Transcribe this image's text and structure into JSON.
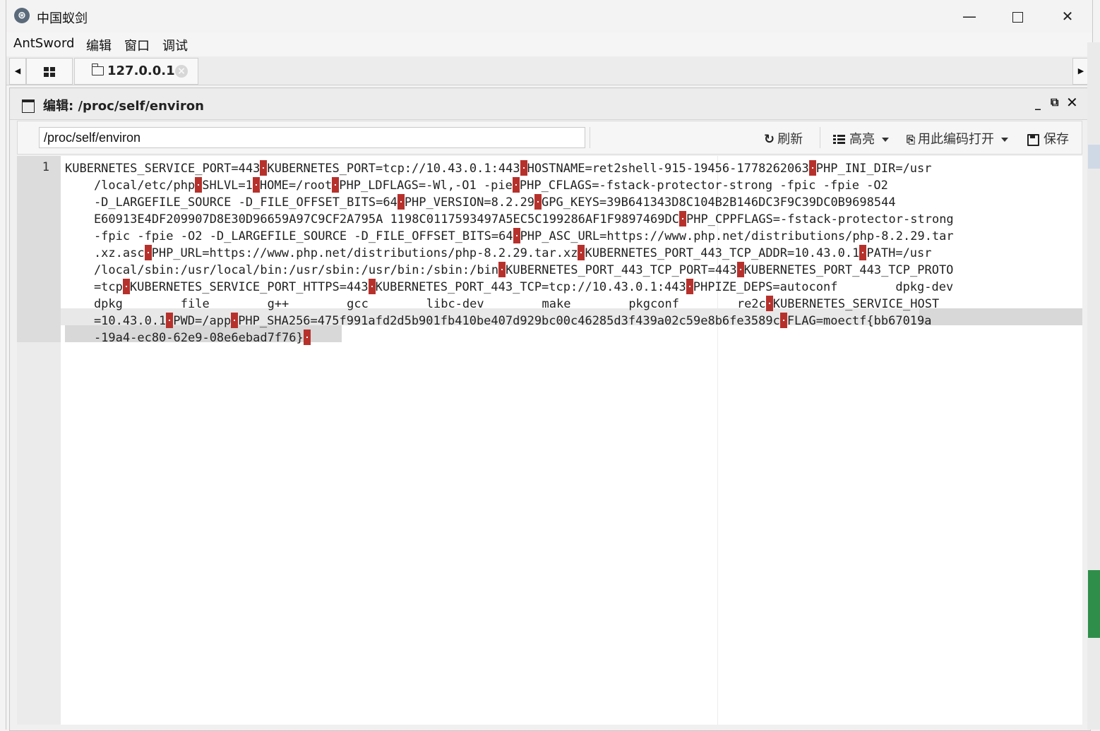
{
  "window": {
    "title": "中国蚁剑",
    "controls": {
      "minimize": "—",
      "close": "✕"
    }
  },
  "menubar": {
    "items": [
      "AntSword",
      "编辑",
      "窗口",
      "调试"
    ]
  },
  "tabs": {
    "host": {
      "label": "127.0.0.1",
      "close": "×"
    }
  },
  "editor_panel": {
    "title": "编辑: /proc/self/environ",
    "controls": {
      "minimize": "_",
      "restore": "⧉",
      "close": "✕"
    },
    "toolbar": {
      "path_value": "/proc/self/environ",
      "refresh_label": "刷新",
      "highlight_label": "高亮",
      "encoding_label": "用此编码打开",
      "save_label": "保存"
    },
    "line_number": "1",
    "file_content": {
      "lines": [
        [
          "KUBERNETES_SERVICE_PORT=443",
          "KUBERNETES_PORT=tcp://10.43.0.1:443",
          "HOSTNAME=ret2shell-915-19456-1778262063",
          "PHP_INI_DIR=/usr"
        ],
        [
          "    /local/etc/php",
          "SHLVL=1",
          "HOME=/root",
          "PHP_LDFLAGS=-Wl,-O1 -pie",
          "PHP_CFLAGS=-fstack-protector-strong -fpic -fpie -O2"
        ],
        [
          "    -D_LARGEFILE_SOURCE -D_FILE_OFFSET_BITS=64",
          "PHP_VERSION=8.2.29",
          "GPG_KEYS=39B641343D8C104B2B146DC3F9C39DC0B9698544"
        ],
        [
          "    E60913E4DF209907D8E30D96659A97C9CF2A795A 1198C0117593497A5EC5C199286AF1F9897469DC",
          "PHP_CPPFLAGS=-fstack-protector-strong"
        ],
        [
          "    -fpic -fpie -O2 -D_LARGEFILE_SOURCE -D_FILE_OFFSET_BITS=64",
          "PHP_ASC_URL=https://www.php.net/distributions/php-8.2.29.tar"
        ],
        [
          "    .xz.asc",
          "PHP_URL=https://www.php.net/distributions/php-8.2.29.tar.xz",
          "KUBERNETES_PORT_443_TCP_ADDR=10.43.0.1",
          "PATH=/usr"
        ],
        [
          "    /local/sbin:/usr/local/bin:/usr/sbin:/usr/bin:/sbin:/bin",
          "KUBERNETES_PORT_443_TCP_PORT=443",
          "KUBERNETES_PORT_443_TCP_PROTO"
        ],
        [
          "    =tcp",
          "KUBERNETES_SERVICE_PORT_HTTPS=443",
          "KUBERNETES_PORT_443_TCP=tcp://10.43.0.1:443",
          "PHPIZE_DEPS=autoconf        dpkg-dev"
        ],
        [
          "    dpkg        file        g++        gcc        libc-dev        make        pkgconf        re2c",
          "KUBERNETES_SERVICE_HOST"
        ],
        [
          "    =10.43.0.1",
          "PWD=/app",
          "PHP_SHA256=475f991afd2d5b901fb410be407d929bc00c46285d3f439a02c59e8b6fe3589c",
          "FLAG=moectf{bb67019a"
        ],
        [
          "    -19a4-ec80-62e9-08e6ebad7f76}",
          ""
        ]
      ]
    }
  },
  "colors": {
    "nul_marker": "#b7312c",
    "selection": "#d8d8d8",
    "gutter": "#ebebeb"
  },
  "icons": {
    "app": "antsword-icon",
    "home_tab": "grid-icon",
    "host_tab": "folder-icon",
    "refresh": "refresh-icon",
    "highlight": "list-icon",
    "encoding": "encoding-icon",
    "save": "save-icon"
  }
}
